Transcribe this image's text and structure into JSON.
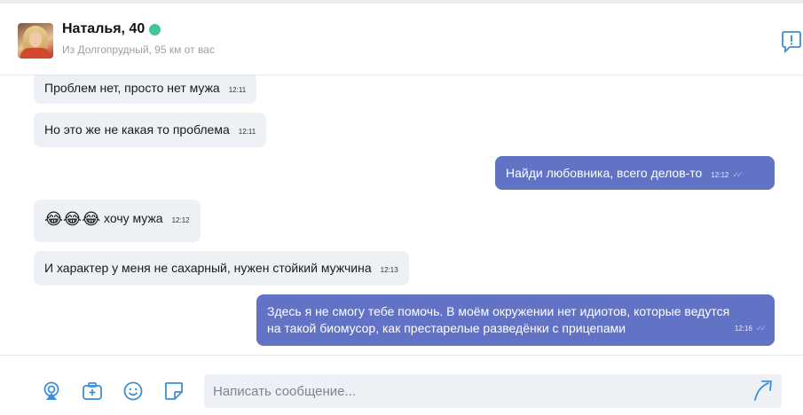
{
  "header": {
    "name": "Наталья, 40",
    "location": "Из Долгопрудный, 95 км от вас",
    "online_color": "#45c49a",
    "report_icon": "report-flag-icon"
  },
  "messages": [
    {
      "direction": "in",
      "text": "Проблем нет, просто нет мужа",
      "time": "12:11"
    },
    {
      "direction": "in",
      "text": "Но это же не какая то проблема",
      "time": "12:11"
    },
    {
      "direction": "out",
      "text": "Найди любовника, всего делов-то",
      "time": "12:12"
    },
    {
      "direction": "in",
      "emoji": "😂😂😂",
      "text": "хочу мужа",
      "time": "12:12"
    },
    {
      "direction": "in",
      "text": "И характер у меня не сахарный, нужен стойкий мужчина",
      "time": "12:13"
    },
    {
      "direction": "out",
      "line1": "Здесь я не смогу тебе помочь. В моём окружении нет идиотов, которые ведутся",
      "line2": "на такой биомусор, как престарелые разведёнки с прицепами",
      "time": "12:16"
    }
  ],
  "composer": {
    "placeholder": "Написать сообщение...",
    "tools": [
      "gift-icon",
      "camera-icon",
      "smile-icon",
      "sticker-icon"
    ],
    "send_icon": "send-icon"
  },
  "colors": {
    "accent": "#6272c4",
    "incoming_bubble": "#edf0f5",
    "icon_blue": "#3e8fd6"
  }
}
